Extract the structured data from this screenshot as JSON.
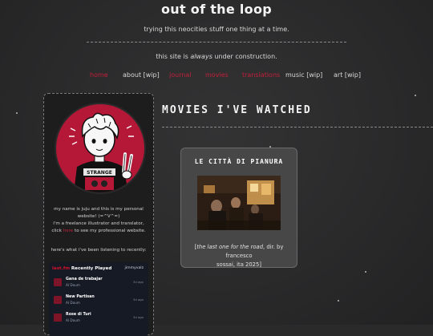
{
  "header": {
    "title": "out of the loop",
    "tagline": "trying this neocities stuff one thing at a time.",
    "construction_prefix": "this site is ",
    "construction_emphasis": "always",
    "construction_suffix": " under construction."
  },
  "nav": {
    "items": [
      {
        "label": "home",
        "color": "#c0203a"
      },
      {
        "label": "about [wip]",
        "color": "#d8d8d8"
      },
      {
        "label": "journal",
        "color": "#c0203a"
      },
      {
        "label": "movies",
        "color": "#c0203a"
      },
      {
        "label": "translations",
        "color": "#c0203a"
      },
      {
        "label": "music [wip]",
        "color": "#d8d8d8"
      },
      {
        "label": "art [wip]",
        "color": "#d8d8d8"
      }
    ]
  },
  "sidebar": {
    "avatar_text": "STRANGE",
    "bio_line1": "my name is juju and this is my personal",
    "bio_line2": "website! (=^V^=)",
    "bio_line3": "i'm a freelance illustrator and translator,",
    "bio_click": "click ",
    "bio_link": "here",
    "bio_after": " to see my professional website.",
    "listening": "here's what i've been listening to recently:",
    "widget": {
      "lastfm": "last.fm",
      "heading": "Recently Played",
      "user": "jimmyvalz",
      "tracks": [
        {
          "name": "Gana de trabajar",
          "artist": "Al Doum",
          "ago": "3d ago"
        },
        {
          "name": "New Partisan",
          "artist": "Al Doum",
          "ago": "3d ago"
        },
        {
          "name": "Rose di Turi",
          "artist": "Al Doum",
          "ago": "3d ago"
        }
      ]
    }
  },
  "main": {
    "section_title": "MOVIES I'VE WATCHED",
    "card": {
      "title": "LE CITTÀ DI PIANURA",
      "caption_open": "[",
      "caption_title": "the last one for the road",
      "caption_rest": ", dir. by francesco",
      "caption_line2": "sossai, ita 2025]"
    }
  },
  "colors": {
    "accent": "#c0203a",
    "avatar_bg": "#b51737",
    "background": "#2a2a2b"
  }
}
